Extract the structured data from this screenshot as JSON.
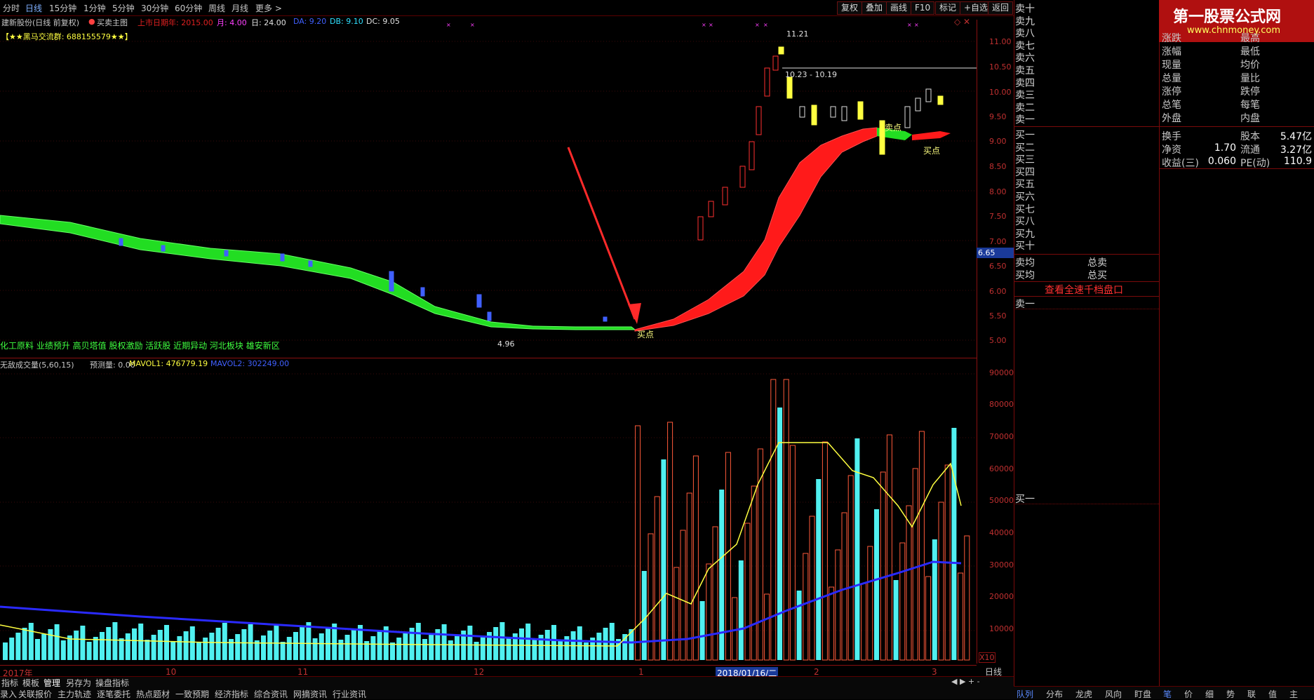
{
  "toolbar": {
    "periods": [
      "分时",
      "日线",
      "15分钟",
      "1分钟",
      "5分钟",
      "30分钟",
      "60分钟",
      "周线",
      "月线",
      "更多 >"
    ],
    "active_period": "日线",
    "buttons": [
      "复权",
      "叠加",
      "画线",
      "F10",
      "标记",
      "+自选",
      "返回"
    ]
  },
  "main_header": {
    "stock": "建新股份(日线 前复权)",
    "indicator": "买卖主图",
    "listed": "上市日期年: 2015.00",
    "month": "月: 4.00",
    "day": "日: 24.00",
    "da": "DA: 9.20",
    "db": "DB: 9.10",
    "dc": "DC: 9.05",
    "group": "【★★黑马交流群: 688155579★★】"
  },
  "main_chart": {
    "price_ticks": [
      "11.00",
      "10.50",
      "10.00",
      "9.50",
      "9.00",
      "8.50",
      "8.00",
      "7.50",
      "7.00",
      "6.50",
      "6.00",
      "5.50",
      "5.00"
    ],
    "current_price": "6.65",
    "high_label": "11.21",
    "low_label": "4.96",
    "range_label": "10.23 - 10.19",
    "buy_label": "买点",
    "sell_label": "卖点",
    "concepts": "化工原料 业绩预升 高贝塔值 股权激励 活跃股 近期异动 河北板块 雄安新区"
  },
  "volume_header": {
    "name": "无敌成交量(5,60,15)",
    "forecast": "预测量: 0.00",
    "mavol1": "MAVOL1: 476779.19",
    "mavol2": "MAVOL2: 302249.00"
  },
  "volume_ticks": [
    "90000",
    "80000",
    "70000",
    "60000",
    "50000",
    "40000",
    "30000",
    "20000",
    "10000"
  ],
  "volume_unit": "X10",
  "date_axis": {
    "labels": [
      "2017年",
      "10",
      "11",
      "12",
      "1",
      "2",
      "3"
    ],
    "cursor_date": "2018/01/16/二",
    "period": "日线"
  },
  "bottom_tabs_row1": [
    "指标",
    "模板",
    "管理",
    "另存为",
    "操盘指标"
  ],
  "bottom_tabs_row2": [
    "录入",
    "关联报价",
    "主力轨迹",
    "逐笔委托",
    "热点题材",
    "一致预期",
    "经济指标",
    "综合资讯",
    "网摘资讯",
    "行业资讯"
  ],
  "order_book": {
    "sells": [
      "卖十",
      "卖九",
      "卖八",
      "卖七",
      "卖六",
      "卖五",
      "卖四",
      "卖三",
      "卖二",
      "卖一"
    ],
    "buys": [
      "买一",
      "买二",
      "买三",
      "买四",
      "买五",
      "买六",
      "买七",
      "买八",
      "买九",
      "买十"
    ],
    "avg_sell": "卖均",
    "avg_buy": "买均",
    "total_sell": "总卖",
    "total_buy": "总买",
    "view_full": "查看全速千档盘口",
    "sell1_box": "卖一",
    "buy1_box": "买一",
    "bottom_tabs": [
      "队列",
      "分布",
      "龙虎",
      "风向",
      "盯盘"
    ]
  },
  "quote_panel": {
    "logo_title": "第一股票公式网",
    "logo_url": "www.chnmoney.com",
    "rows1": [
      [
        "涨跌",
        "最高"
      ],
      [
        "涨幅",
        "最低"
      ],
      [
        "现量",
        "均价"
      ],
      [
        "总量",
        "量比"
      ],
      [
        "涨停",
        "跌停"
      ],
      [
        "总笔",
        "每笔"
      ],
      [
        "外盘",
        "内盘"
      ]
    ],
    "rows2": [
      {
        "l1": "换手",
        "v1": "",
        "l2": "股本",
        "v2": "5.47亿"
      },
      {
        "l1": "净资",
        "v1": "1.70",
        "l2": "流通",
        "v2": "3.27亿"
      },
      {
        "l1": "收益(三)",
        "v1": "0.060",
        "l2": "PE(动)",
        "v2": "110.9"
      }
    ],
    "bottom_tabs": [
      "笔",
      "价",
      "细",
      "势",
      "联",
      "值",
      "主"
    ]
  },
  "colors": {
    "up": "#ff2020",
    "down": "#4060ff",
    "band_up": "#ff1a1a",
    "band_down": "#33ff33",
    "axis": "#c03030"
  }
}
